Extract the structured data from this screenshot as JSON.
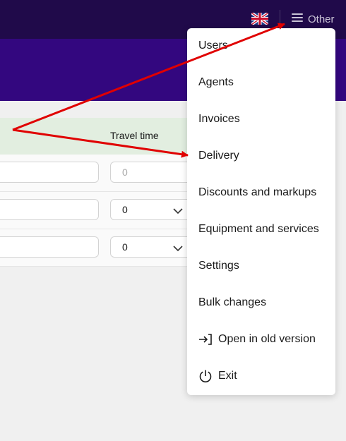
{
  "header": {
    "menu_label": "Other",
    "icons": {
      "flag": "uk-flag-icon",
      "menu": "hamburger-icon"
    }
  },
  "table": {
    "column_travel_time": "Travel time",
    "rows": [
      {
        "travel_time": "0",
        "is_placeholder": true
      },
      {
        "travel_time": "0",
        "is_placeholder": false
      },
      {
        "travel_time": "0",
        "is_placeholder": false
      }
    ]
  },
  "menu": {
    "items": [
      {
        "label": "Users"
      },
      {
        "label": "Agents"
      },
      {
        "label": "Invoices"
      },
      {
        "label": "Delivery"
      },
      {
        "label": "Discounts and markups"
      },
      {
        "label": "Equipment and services"
      },
      {
        "label": "Settings"
      },
      {
        "label": "Bulk changes"
      },
      {
        "label": "Open in old version",
        "icon": "login-arrow-icon"
      },
      {
        "label": "Exit",
        "icon": "power-icon"
      }
    ]
  },
  "colors": {
    "topbar": "#200a4a",
    "band": "#33077f",
    "table_header": "#e2eee0",
    "annotation": "#e00000"
  }
}
